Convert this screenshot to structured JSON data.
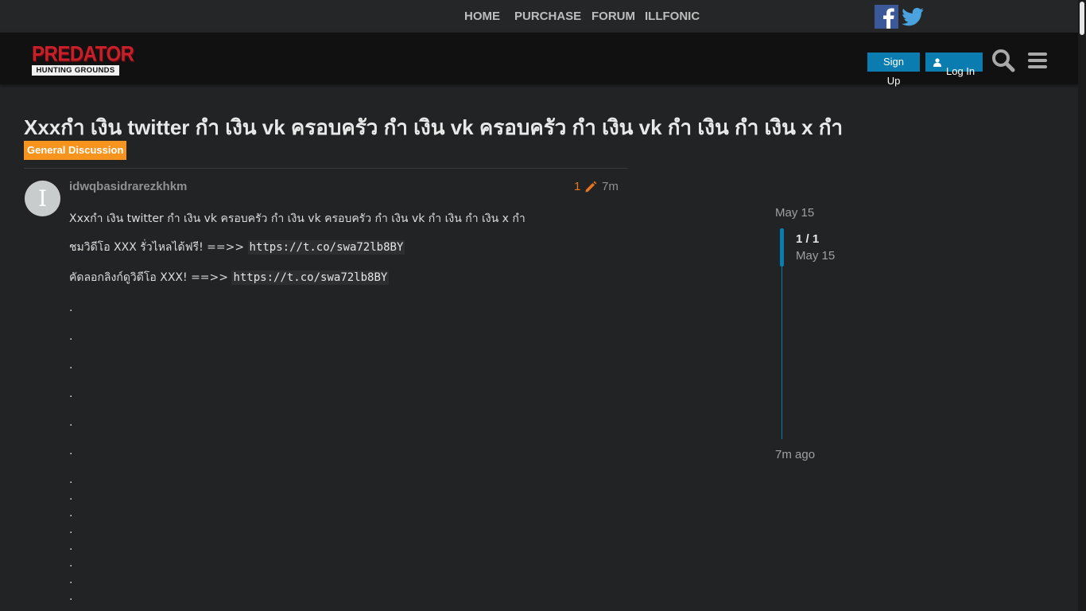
{
  "topnav": {
    "links": [
      "HOME",
      "PURCHASE",
      "FORUM",
      "ILLFONIC"
    ],
    "social": [
      "facebook-icon",
      "twitter-icon"
    ]
  },
  "header": {
    "logo_line1": "PREDATOR",
    "logo_line2": "HUNTING GROUNDS",
    "signup_label": "Sign Up",
    "login_label": "Log In",
    "accent_color": "#0a7cb0"
  },
  "topic": {
    "title": "Xxxกำ เงิน twitter กำ เงิน vk ครอบครัว กำ เงิน vk ครอบครัว กำ เงิน vk กำ เงิน กำ เงิน x กำ",
    "category": "General Discussion",
    "category_color": "#f7941d"
  },
  "post": {
    "avatar_letter": "I",
    "username": "idwqbasidrarezkhkm",
    "edit_count": "1",
    "age": "7m",
    "line1": "Xxxกำ เงิน twitter กำ เงิน vk ครอบครัว กำ เงิน vk ครอบครัว กำ เงิน vk กำ เงิน กำ เงิน x กำ",
    "line2_text": "ชมวิดีโอ XXX รั่วไหลได้ฟรี! ==>> ",
    "line2_link": "https://t.co/swa72lb8BY",
    "line3_text": "คัดลอกลิงก์ดูวิดีโอ XXX! ==>> ",
    "line3_link": "https://t.co/swa72lb8BY",
    "dot": "."
  },
  "timeline": {
    "top_date": "May 15",
    "count": "1 / 1",
    "current_date": "May 15",
    "bottom": "7m ago"
  }
}
